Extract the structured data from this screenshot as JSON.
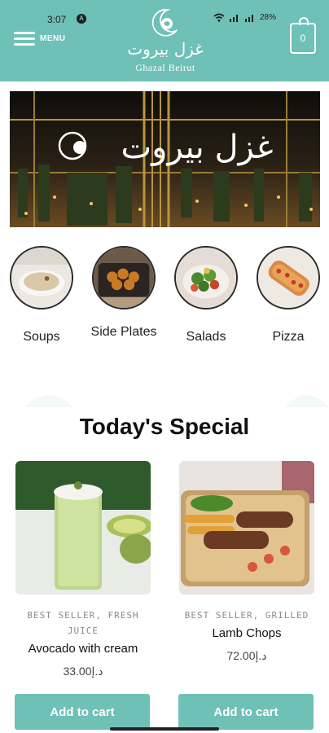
{
  "status_bar": {
    "time": "3:07",
    "notification_letter": "A",
    "battery": "28%"
  },
  "header": {
    "menu_label": "MENU",
    "logo_arabic": "غزل بيروت",
    "logo_english": "Ghazal Beirut",
    "cart_count": "0"
  },
  "banner": {
    "sign_text": "غزل بيروت"
  },
  "categories": [
    {
      "label": "Soups"
    },
    {
      "label": "Side Plates"
    },
    {
      "label": "Salads"
    },
    {
      "label": "Pizza"
    }
  ],
  "section_title": "Today's Special",
  "products": [
    {
      "tags": "BEST SELLER, FRESH JUICE",
      "name": "Avocado with cream",
      "price": "33.00د.إ",
      "button": "Add to cart"
    },
    {
      "tags": "BEST SELLER, GRILLED",
      "name": "Lamb Chops",
      "price": "د.إ72.00",
      "button": "Add to cart"
    }
  ],
  "colors": {
    "brand": "#6fc0b6",
    "banner_bg": "#1a140c",
    "sign": "#ffffff"
  }
}
